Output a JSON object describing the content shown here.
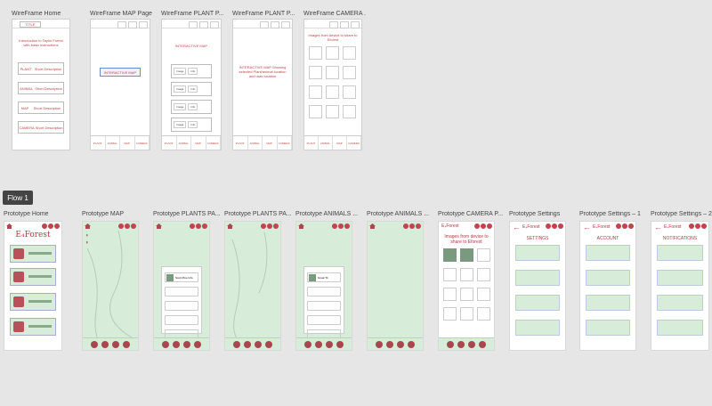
{
  "wireframe": {
    "labels": [
      "WireFrame Home",
      "WireFrame MAP Page",
      "WireFrame PLANT  P...",
      "WireFrame PLANT  P...",
      "WireFrame CAMERA ..."
    ],
    "home_title": "TITLE",
    "home_intro": "Introduction to Taylor Forest with basic instructions",
    "home_items": [
      {
        "label": "PLANT",
        "desc": "Short Description"
      },
      {
        "label": "ANIMAL",
        "desc": "Short Description"
      },
      {
        "label": "MAP",
        "desc": "Short Description"
      },
      {
        "label": "CAMERA",
        "desc": "Short Description"
      }
    ],
    "map_label": "INTERACTIVE MAP",
    "plant_map_label": "INTERACTIVE MAP",
    "plant2_text": "INTERACTIVE MAP Showing selected Plant/animal location and user location",
    "camera_text": "Images from device to share to Eforest",
    "image_label": "Image",
    "info_label": "Info",
    "bottom_nav": [
      "PLANT",
      "ANIMAL",
      "MAP",
      "CAMERA"
    ]
  },
  "flow_tag": "Flow 1",
  "prototype": {
    "labels": [
      "Prototype Home",
      "Prototype MAP",
      "Prototype PLANTS PA...",
      "Prototype PLANTS PA...",
      "Prototype ANIMALS ...",
      "Prototype ANIMALS ...",
      "Prototype CAMERA P...",
      "Prototype Settings",
      "Prototype Settings – 1",
      "Prototype Settings – 2"
    ],
    "logo": "E₄Forest",
    "brand": "E₄Forest",
    "camera_text": "Images from device to share to Eforest",
    "settings_title": "SETTINGS",
    "account_title": "ACCOUNT",
    "notifications_title": "NOTIFICATIONS",
    "plant_card": "Scott Pine Info",
    "animal_card": "Great Tit"
  }
}
